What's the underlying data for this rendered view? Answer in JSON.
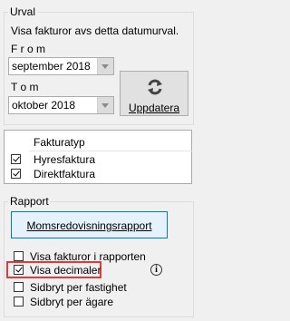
{
  "urval": {
    "legend": "Urval",
    "description": "Visa fakturor avs detta datumurval.",
    "from_label": "F r o m",
    "from_value": "september 2018",
    "to_label": "T o m",
    "to_value": "oktober 2018",
    "update_button": "Uppdatera"
  },
  "fakturatyp": {
    "header": "Fakturatyp",
    "items": [
      {
        "label": "Hyresfaktura",
        "checked": true
      },
      {
        "label": "Direktfaktura",
        "checked": true
      }
    ]
  },
  "rapport": {
    "legend": "Rapport",
    "report_button": "Momsredovisningsrapport",
    "options": [
      {
        "label": "Visa fakturor i rapporten",
        "checked": false
      },
      {
        "label": "Visa decimaler",
        "checked": true
      },
      {
        "label": "Sidbryt per fastighet",
        "checked": false
      },
      {
        "label": "Sidbryt per ägare",
        "checked": false
      }
    ],
    "highlight_color": "#e03a3a"
  }
}
